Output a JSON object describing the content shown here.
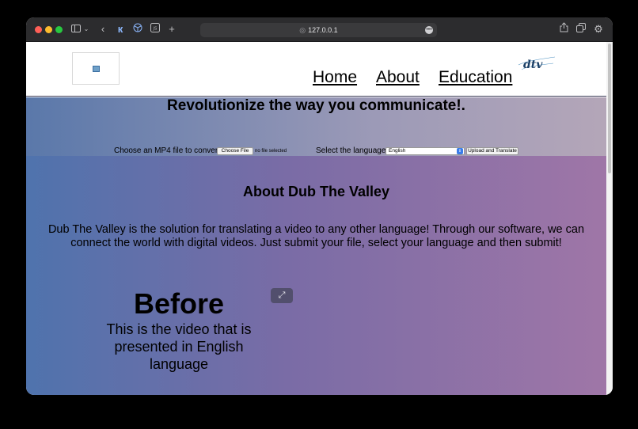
{
  "browser": {
    "address": "127.0.0.1",
    "icons": [
      "sidebar-icon",
      "chevron-down-icon",
      "back-icon",
      "extension-icon",
      "cube-icon",
      "js-icon",
      "new-tab-icon",
      "share-icon",
      "tabs-icon",
      "settings-icon"
    ]
  },
  "nav": {
    "items": [
      {
        "label": "Home"
      },
      {
        "label": "About"
      },
      {
        "label": "Education"
      }
    ],
    "logo_text": "dtv"
  },
  "banner": {
    "title": "Revolutionize the way you communicate!.",
    "file_label": "Choose an MP4 file to convert:",
    "choose_file_button": "Choose File",
    "no_file_text": "no file selected",
    "language_label": "Select the language:",
    "language_selected": "English",
    "upload_button": "Upload and Translate"
  },
  "about": {
    "title": "About Dub The Valley",
    "text": "Dub The Valley is the solution for translating a video to any other language! Through our software, we can connect the world with digital videos. Just submit your file, select your language and then submit!"
  },
  "before": {
    "title": "Before",
    "text": "This is the video that is presented in English language"
  },
  "colors": {
    "gradient_start": "#4f73ad",
    "gradient_end": "#9f76a7",
    "toolbar": "#2c2c2e"
  }
}
